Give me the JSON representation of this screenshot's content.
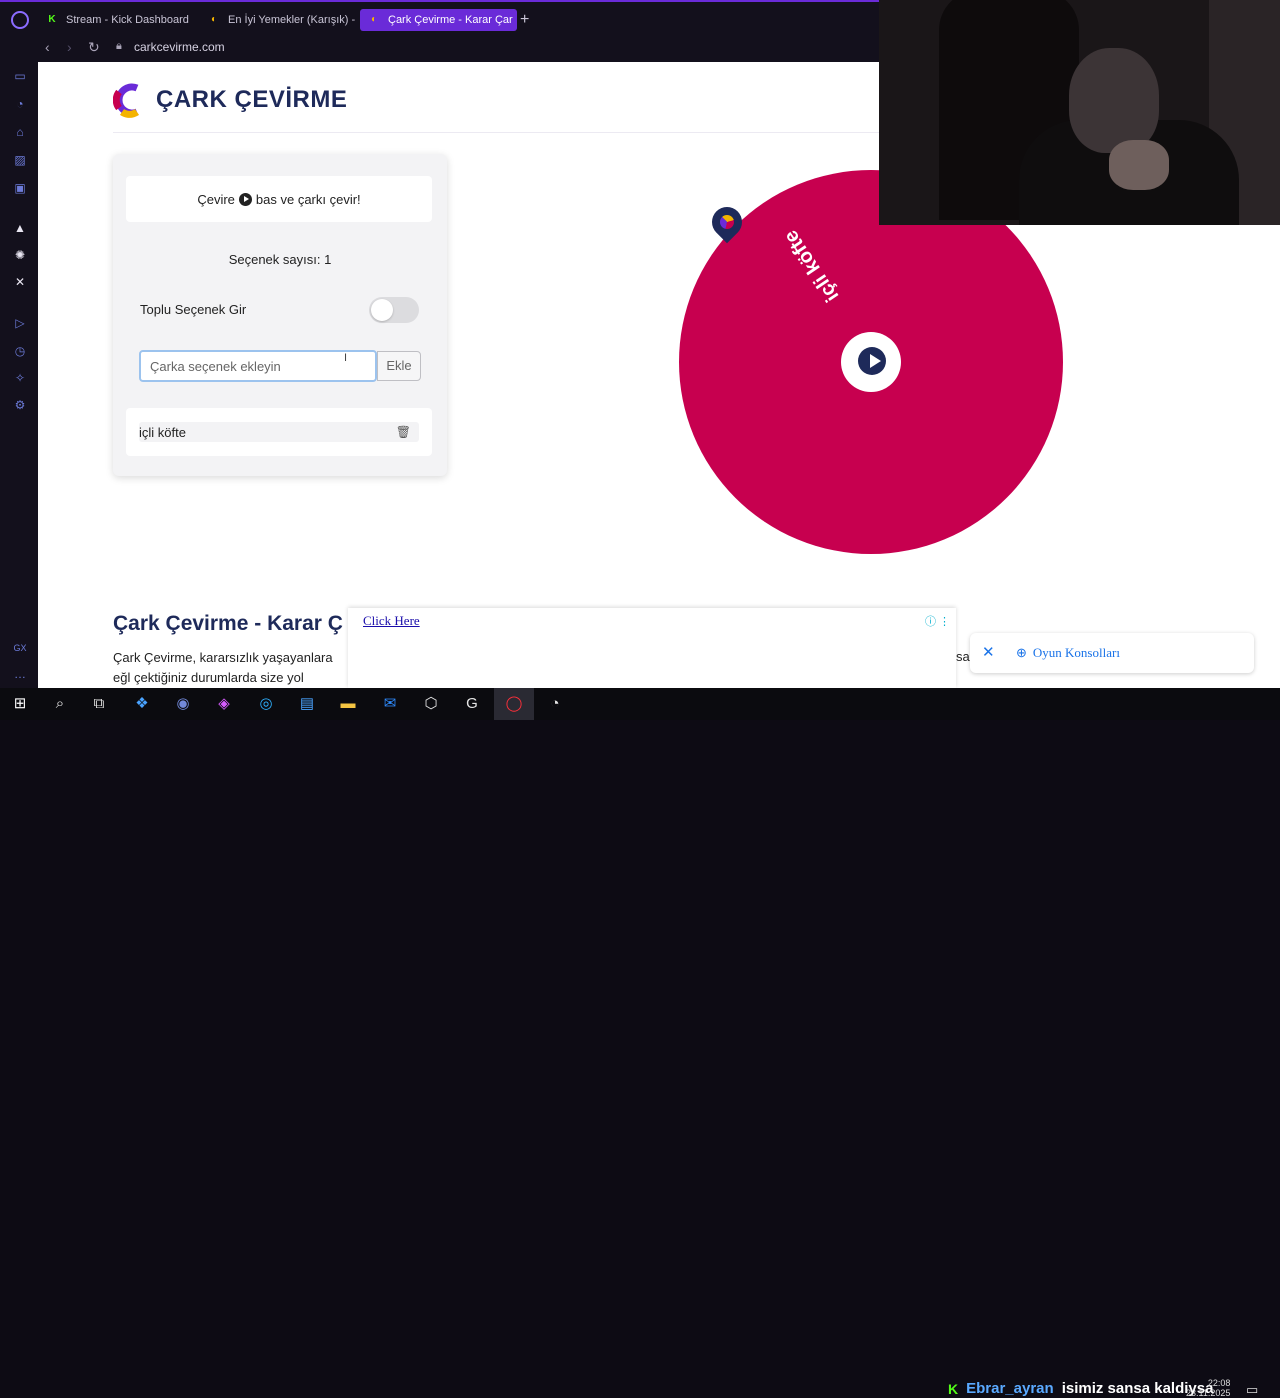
{
  "browser": {
    "tabs": [
      {
        "label": "Stream - Kick Dashboard",
        "icon": "K"
      },
      {
        "label": "En İyi Yemekler (Karışık) -",
        "icon": "◐"
      },
      {
        "label": "Çark Çevirme - Karar Çar",
        "icon": "◐"
      }
    ],
    "new_tab": "+",
    "url": "carkcevirme.com"
  },
  "site": {
    "brand": "ÇARK ÇEVİRME",
    "hint_before": "Çevire",
    "hint_after": "bas ve çarkı çevir!",
    "option_count": "Seçenek sayısı: 1",
    "bulk_label": "Toplu Seçenek Gir",
    "bulk_enabled": false,
    "input_placeholder": "Çarka seçenek ekleyin",
    "input_value": "",
    "add_label": "Ekle",
    "options": [
      "içli köfte"
    ],
    "wheel_color": "#c7004f",
    "article_title": "Çark Çevirme - Karar Ç",
    "article_text": "Çark Çevirme, kararsızlık yaşayanlara eğl çektiğiniz durumlarda size yol gösterebil"
  },
  "ads": {
    "link_text": "Click Here",
    "right_text": "sa",
    "chip_label": "Oyun Konsolları"
  },
  "taskbar": {
    "chat_user": "Ebrar_ayran",
    "chat_message": "isimiz sansa kaldiysa",
    "time": "22:08",
    "date": "23.11.2025"
  }
}
